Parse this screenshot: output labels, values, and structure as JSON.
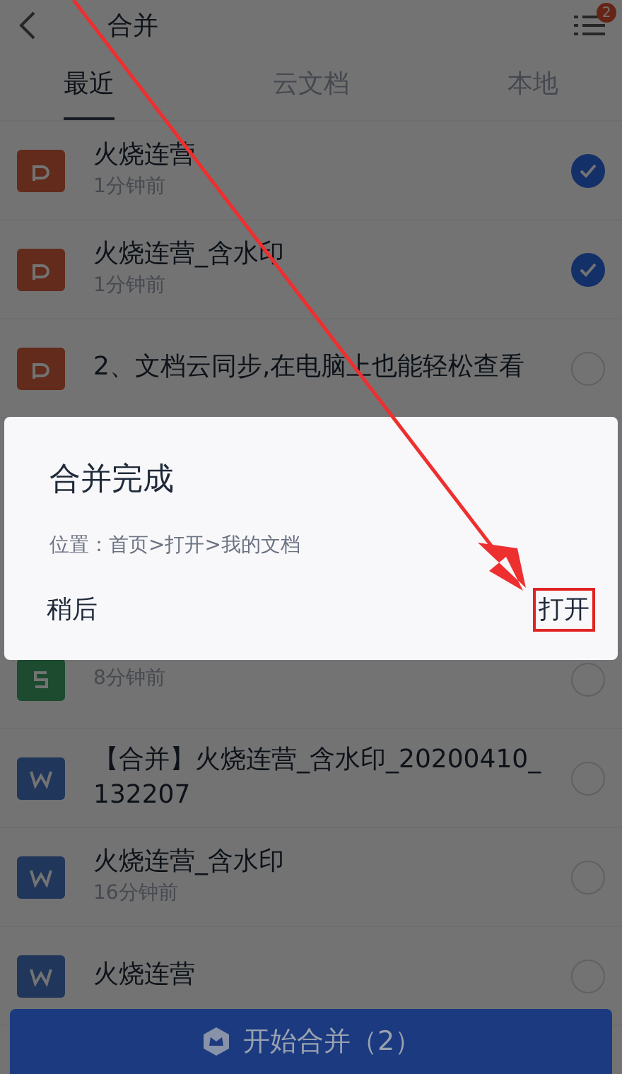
{
  "header": {
    "title": "合并",
    "menu_badge": "2"
  },
  "tabs": [
    {
      "label": "最近",
      "selected": true
    },
    {
      "label": "云文档",
      "selected": false
    },
    {
      "label": "本地",
      "selected": false
    }
  ],
  "files": [
    {
      "kind": "ppt",
      "title": "火烧连营",
      "time": "1分钟前",
      "checked": true
    },
    {
      "kind": "ppt",
      "title": "火烧连营_含水印",
      "time": "1分钟前",
      "checked": true
    },
    {
      "kind": "ppt",
      "title": "2、文档云同步,在电脑上也能轻松查看",
      "checked": false
    },
    {
      "kind": "sheet",
      "time": "8分钟前",
      "checked": false
    },
    {
      "kind": "word",
      "title": "【合并】火烧连营_含水印_20200410_132207",
      "checked": false
    },
    {
      "kind": "word",
      "title": "火烧连营_含水印",
      "time": "16分钟前",
      "checked": false
    },
    {
      "kind": "word",
      "title": "火烧连营",
      "checked": false
    }
  ],
  "merge_button": "开始合并（2）",
  "dialog": {
    "title": "合并完成",
    "message": "位置：首页>打开>我的文档",
    "buttons": [
      "稍后",
      "打开"
    ]
  }
}
